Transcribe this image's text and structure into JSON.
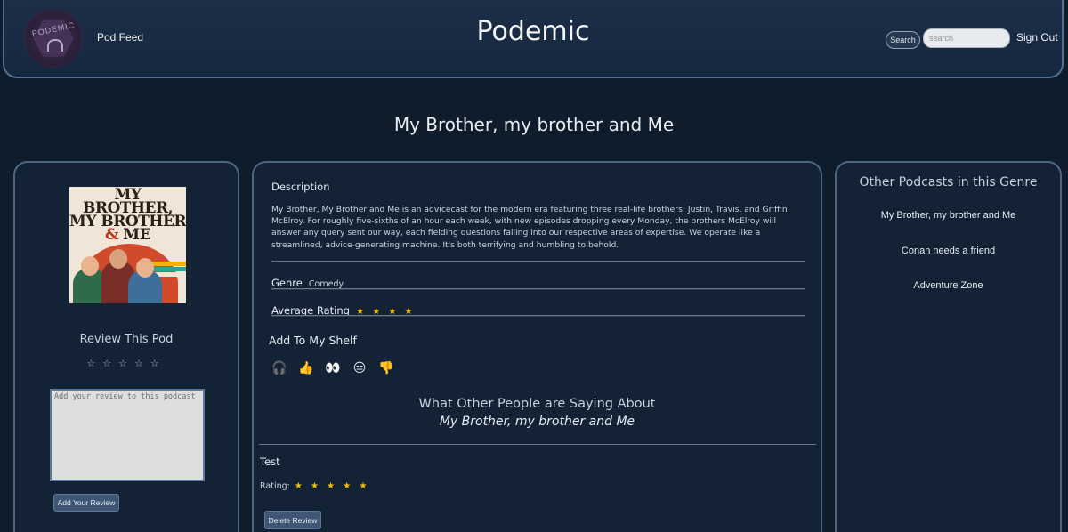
{
  "header": {
    "logo_text": "PODEMIC",
    "nav_link": "Pod Feed",
    "site_title": "Podemic",
    "search_button": "Search",
    "search_placeholder": "search",
    "sign_out": "Sign Out"
  },
  "podcast": {
    "title": "My Brother, my brother and Me",
    "cover_line1": "MY",
    "cover_line2": "BROTHER,",
    "cover_line3": "MY BROTHER",
    "cover_line4_amp": "&",
    "cover_line4": "ME",
    "description_label": "Description",
    "description": "My Brother, My Brother and Me is an advicecast for the modern era featuring three real-life brothers: Justin, Travis, and Griffin McElroy. For roughly five-sixths of an hour each week, with new episodes dropping every Monday, the brothers McElroy will answer any query sent our way, each fielding questions falling into our respective areas of expertise. We operate like a streamlined, advice-generating machine. It's both terrifying and humbling to behold.",
    "genre_label": "Genre",
    "genre": "Comedy",
    "avg_rating_label": "Average Rating",
    "avg_rating_stars": "★ ★ ★ ★",
    "avg_rating_value": 4
  },
  "review_form": {
    "heading": "Review This Pod",
    "stars": [
      "☆",
      "☆",
      "☆",
      "☆",
      "☆"
    ],
    "textarea_placeholder": "Add your review to this podcast",
    "submit_label": "Add Your Review"
  },
  "shelf": {
    "title": "Add To My Shelf",
    "icons": [
      {
        "name": "headphones-icon",
        "glyph": "🎧"
      },
      {
        "name": "thumbs-up-icon",
        "glyph": "👍"
      },
      {
        "name": "eyes-icon",
        "glyph": "👀"
      },
      {
        "name": "expressionless-face-icon",
        "glyph": "😑"
      },
      {
        "name": "thumbs-down-icon",
        "glyph": "👎"
      }
    ]
  },
  "reviews_section": {
    "title": "What Other People are Saying About",
    "subtitle": "My Brother, my brother and Me",
    "reviews": [
      {
        "user": "Test",
        "rating_label": "Rating:",
        "rating_stars": "★ ★ ★ ★ ★",
        "rating_value": 5,
        "delete_label": "Delete Review"
      }
    ]
  },
  "genre_sidebar": {
    "heading": "Other Podcasts in this Genre",
    "items": [
      "My Brother, my brother and Me",
      "Conan needs a friend",
      "Adventure Zone"
    ]
  },
  "colors": {
    "background": "#0f1c2c",
    "panel": "#142235",
    "panel_border": "#4b6784",
    "star_gold": "#f2c200",
    "button": "#3f5675"
  }
}
